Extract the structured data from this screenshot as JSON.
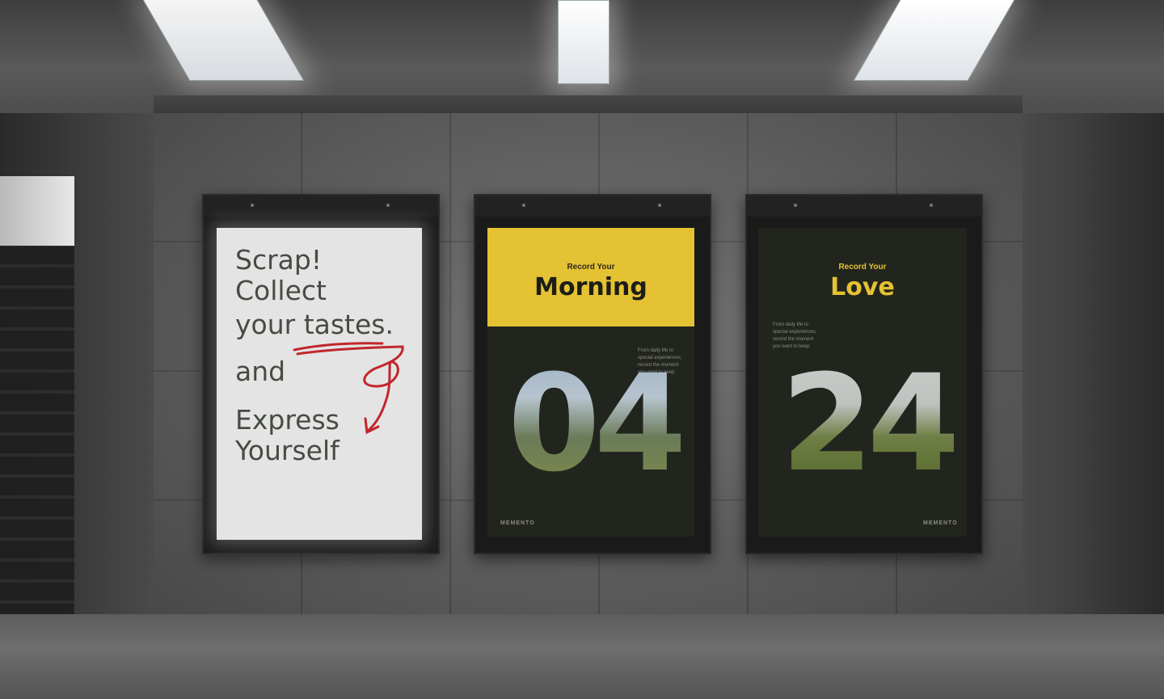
{
  "colors": {
    "yellow": "#e5c233",
    "poster_dark": "#22251e",
    "handwriting": "#c2262c",
    "concrete": "#5f5f5f"
  },
  "poster_left": {
    "line1": "Scrap!",
    "line2": "Collect",
    "line3": "your tastes.",
    "line4": "and",
    "line5": "Express",
    "line6": "Yourself"
  },
  "poster_morning": {
    "subtitle": "Record Your",
    "title": "Morning",
    "body": "From daily life to\nspecial experiences,\nrecord the moment\nyou want to keep.",
    "number": "04",
    "brand": "MEMENTO"
  },
  "poster_love": {
    "subtitle": "Record Your",
    "title": "Love",
    "body": "From daily life to\nspecial experiences,\nrecord the moment\nyou want to keep.",
    "number": "24",
    "brand": "MEMENTO"
  }
}
